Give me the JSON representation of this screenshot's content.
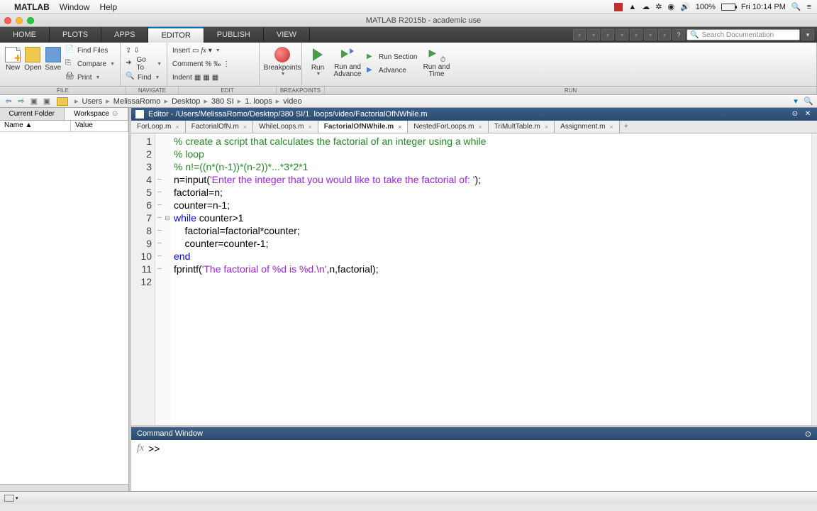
{
  "mac_menu": {
    "app": "MATLAB",
    "items": [
      "Window",
      "Help"
    ],
    "tray": {
      "battery": "100%",
      "clock": "Fri 10:14 PM"
    }
  },
  "window": {
    "title": "MATLAB R2015b - academic use"
  },
  "ribbon": {
    "tabs": [
      "HOME",
      "PLOTS",
      "APPS",
      "EDITOR",
      "PUBLISH",
      "VIEW"
    ],
    "active": "EDITOR",
    "search_placeholder": "Search Documentation"
  },
  "toolstrip": {
    "file": {
      "new": "New",
      "open": "Open",
      "save": "Save",
      "find_files": "Find Files",
      "compare": "Compare",
      "print": "Print"
    },
    "navigate": {
      "goto": "Go To",
      "find": "Find"
    },
    "edit": {
      "insert": "Insert",
      "comment": "Comment",
      "indent": "Indent"
    },
    "breakpoints": "Breakpoints",
    "run": {
      "run": "Run",
      "run_advance": "Run and\nAdvance",
      "run_section": "Run Section",
      "advance": "Advance",
      "run_time": "Run and\nTime"
    },
    "groups": [
      "FILE",
      "NAVIGATE",
      "EDIT",
      "BREAKPOINTS",
      "RUN"
    ]
  },
  "path": {
    "crumbs": [
      "Users",
      "MelissaRomo",
      "Desktop",
      "380 SI",
      "1. loops",
      "video"
    ]
  },
  "left_panel": {
    "tabs": [
      "Current Folder",
      "Workspace"
    ],
    "active": "Workspace",
    "cols": [
      "Name ▲",
      "Value"
    ]
  },
  "editor": {
    "title_prefix": "Editor - ",
    "full_path": "/Users/MelissaRomo/Desktop/380 SI/1. loops/video/FactorialOfNWhile.m",
    "tabs": [
      "ForLoop.m",
      "FactorialOfN.m",
      "WhileLoops.m",
      "FactorialOfNWhile.m",
      "NestedForLoops.m",
      "TriMultTable.m",
      "Assignment.m"
    ],
    "active_tab": "FactorialOfNWhile.m",
    "code": [
      {
        "n": 1,
        "mark": "",
        "fold": "",
        "tokens": [
          {
            "t": "% create a script that calculates the factorial of an integer using a while",
            "c": "comment"
          }
        ]
      },
      {
        "n": 2,
        "mark": "",
        "fold": "",
        "tokens": [
          {
            "t": "% loop",
            "c": "comment"
          }
        ]
      },
      {
        "n": 3,
        "mark": "",
        "fold": "",
        "tokens": [
          {
            "t": "% n!=((n*(n-1))*(n-2))*...*3*2*1",
            "c": "comment"
          }
        ]
      },
      {
        "n": 4,
        "mark": "–",
        "fold": "",
        "tokens": [
          {
            "t": "n=input(",
            "c": "text"
          },
          {
            "t": "'Enter the integer that you would like to take the factorial of: '",
            "c": "string"
          },
          {
            "t": ");",
            "c": "text"
          }
        ]
      },
      {
        "n": 5,
        "mark": "–",
        "fold": "",
        "tokens": [
          {
            "t": "factorial=n;",
            "c": "text"
          }
        ]
      },
      {
        "n": 6,
        "mark": "–",
        "fold": "",
        "tokens": [
          {
            "t": "counter=n-1;",
            "c": "text"
          }
        ]
      },
      {
        "n": 7,
        "mark": "–",
        "fold": "⊟",
        "tokens": [
          {
            "t": "while",
            "c": "keyword"
          },
          {
            "t": " counter>1",
            "c": "text"
          }
        ]
      },
      {
        "n": 8,
        "mark": "–",
        "fold": "",
        "indent": 1,
        "tokens": [
          {
            "t": "    factorial=factorial*counter;",
            "c": "text"
          }
        ]
      },
      {
        "n": 9,
        "mark": "–",
        "fold": "",
        "indent": 1,
        "tokens": [
          {
            "t": "    counter=counter-1;",
            "c": "text"
          }
        ]
      },
      {
        "n": 10,
        "mark": "–",
        "fold": "",
        "tokens": [
          {
            "t": "end",
            "c": "keyword"
          }
        ]
      },
      {
        "n": 11,
        "mark": "–",
        "fold": "",
        "tokens": [
          {
            "t": "fprintf(",
            "c": "text"
          },
          {
            "t": "'The factorial of %d is %d.\\n'",
            "c": "string"
          },
          {
            "t": ",n,factorial);",
            "c": "text"
          }
        ]
      },
      {
        "n": 12,
        "mark": "",
        "fold": "",
        "tokens": []
      }
    ]
  },
  "command_window": {
    "title": "Command Window",
    "prompt": ">>"
  }
}
